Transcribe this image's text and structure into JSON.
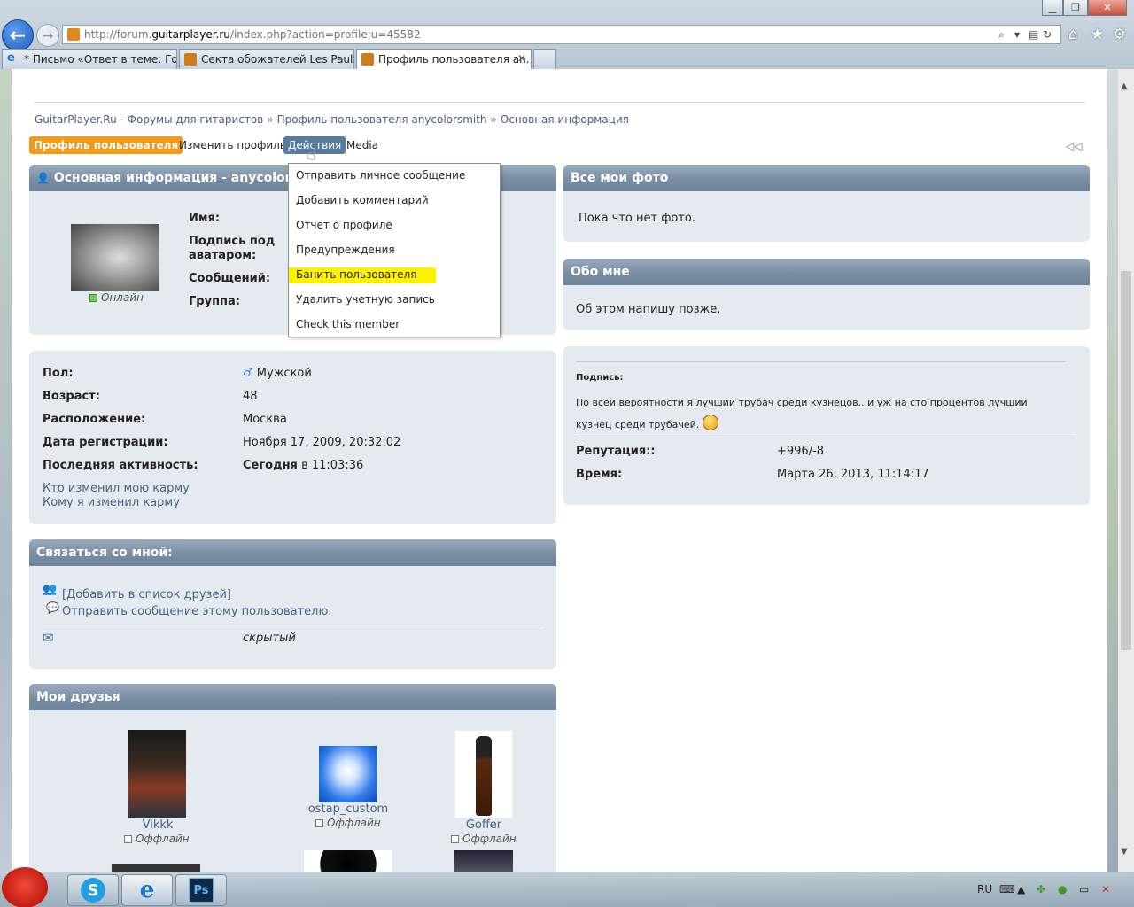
{
  "browser": {
    "url_prefix": "http://forum.",
    "url_domain": "guitarplayer.ru",
    "url_rest": "/index.php?action=profile;u=45582",
    "tabs": [
      {
        "label": "* Письмо «Ответ в теме: Гост...",
        "active": false
      },
      {
        "label": "Секта обожателей Les Paul",
        "active": false
      },
      {
        "label": "Профиль пользователя an...",
        "active": true
      }
    ],
    "tab_close": "✕"
  },
  "breadcrumb": {
    "items": [
      "GuitarPlayer.Ru - Форумы для гитаристов",
      "Профиль пользователя anycolorsmith",
      "Основная информация"
    ],
    "separator": "»"
  },
  "menu": {
    "profile": "Профиль пользователя",
    "edit": "Изменить профиль",
    "actions": "Действия",
    "media": "Media"
  },
  "dropdown": {
    "items": [
      "Отправить личное сообщение",
      "Добавить комментарий",
      "Отчет о профиле",
      "Предупреждения",
      "Банить пользователя",
      "Удалить учетную запись",
      "Check this member"
    ],
    "highlighted_index": 4
  },
  "basic_info": {
    "title": "Основная информация - anycolorsm",
    "status": "Онлайн",
    "labels": {
      "name": "Имя:",
      "signature_under_avatar": "Подпись под аватаром:",
      "messages": "Сообщений:",
      "group": "Группа:"
    }
  },
  "details": {
    "rows": [
      {
        "label": "Пол:",
        "value": "Мужской"
      },
      {
        "label": "Возраст:",
        "value": "48"
      },
      {
        "label": "Расположение:",
        "value": "Москва"
      },
      {
        "label": "Дата регистрации:",
        "value": "Ноября 17, 2009, 20:32:02"
      },
      {
        "label": "Последняя активность:",
        "value_bold": "Сегодня",
        "value": "в 11:03:36"
      }
    ],
    "links": [
      "Кто изменил мою карму",
      "Кому я изменил карму"
    ]
  },
  "contact": {
    "title": "Связаться со мной:",
    "add_friend": "[Добавить в список друзей]",
    "send_message": "Отправить сообщение этому пользователю.",
    "email": "скрытый"
  },
  "friends": {
    "title": "Мои друзья",
    "items": [
      {
        "name": "Vikkk",
        "status": "Оффлайн"
      },
      {
        "name": "ostap_custom",
        "status": "Оффлайн"
      },
      {
        "name": "Goffer",
        "status": "Оффлайн"
      }
    ]
  },
  "photos": {
    "title": "Все мои фото",
    "text": "Пока что нет фото."
  },
  "about": {
    "title": "Обо мне",
    "text": "Об этом напишу позже."
  },
  "signature": {
    "label": "Подпись:",
    "text": "По всей вероятности я лучший трубач среди кузнецов...и уж на сто процентов лучший кузнец среди трубачей.",
    "reputation_label": "Репутация::",
    "reputation": "+996/-8",
    "time_label": "Время:",
    "time": "Марта 26, 2013, 11:14:17"
  },
  "taskbar": {
    "lang": "RU",
    "ps": "Ps"
  },
  "colors": {
    "accent_orange": "#f39a16",
    "header_blue": "#7a8ea3",
    "link": "#4b5f82",
    "highlight": "#fff200"
  }
}
